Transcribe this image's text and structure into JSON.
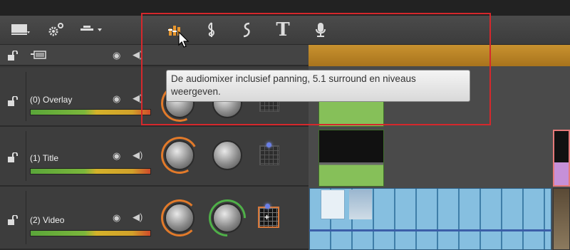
{
  "toolbar": {
    "icons": [
      {
        "name": "track-view-icon"
      },
      {
        "name": "settings-icon"
      },
      {
        "name": "snap-dropdown-icon"
      },
      {
        "name": "audio-mixer-icon"
      },
      {
        "name": "music-score-icon"
      },
      {
        "name": "soundtrack-icon"
      },
      {
        "name": "title-icon",
        "glyph": "T"
      },
      {
        "name": "microphone-icon"
      }
    ]
  },
  "tooltip": {
    "text": "De audiomixer inclusief panning, 5.1 surround en niveaus weergeven."
  },
  "tracks": [
    {
      "name": "(0) Overlay"
    },
    {
      "name": "(1) Title"
    },
    {
      "name": "(2) Video"
    }
  ],
  "colors": {
    "highlight": "#d5282c",
    "ruler": "#b98526",
    "knob_orange": "#e27a2a",
    "knob_green": "#4fb048",
    "clip_blue": "#8cc0e0"
  }
}
